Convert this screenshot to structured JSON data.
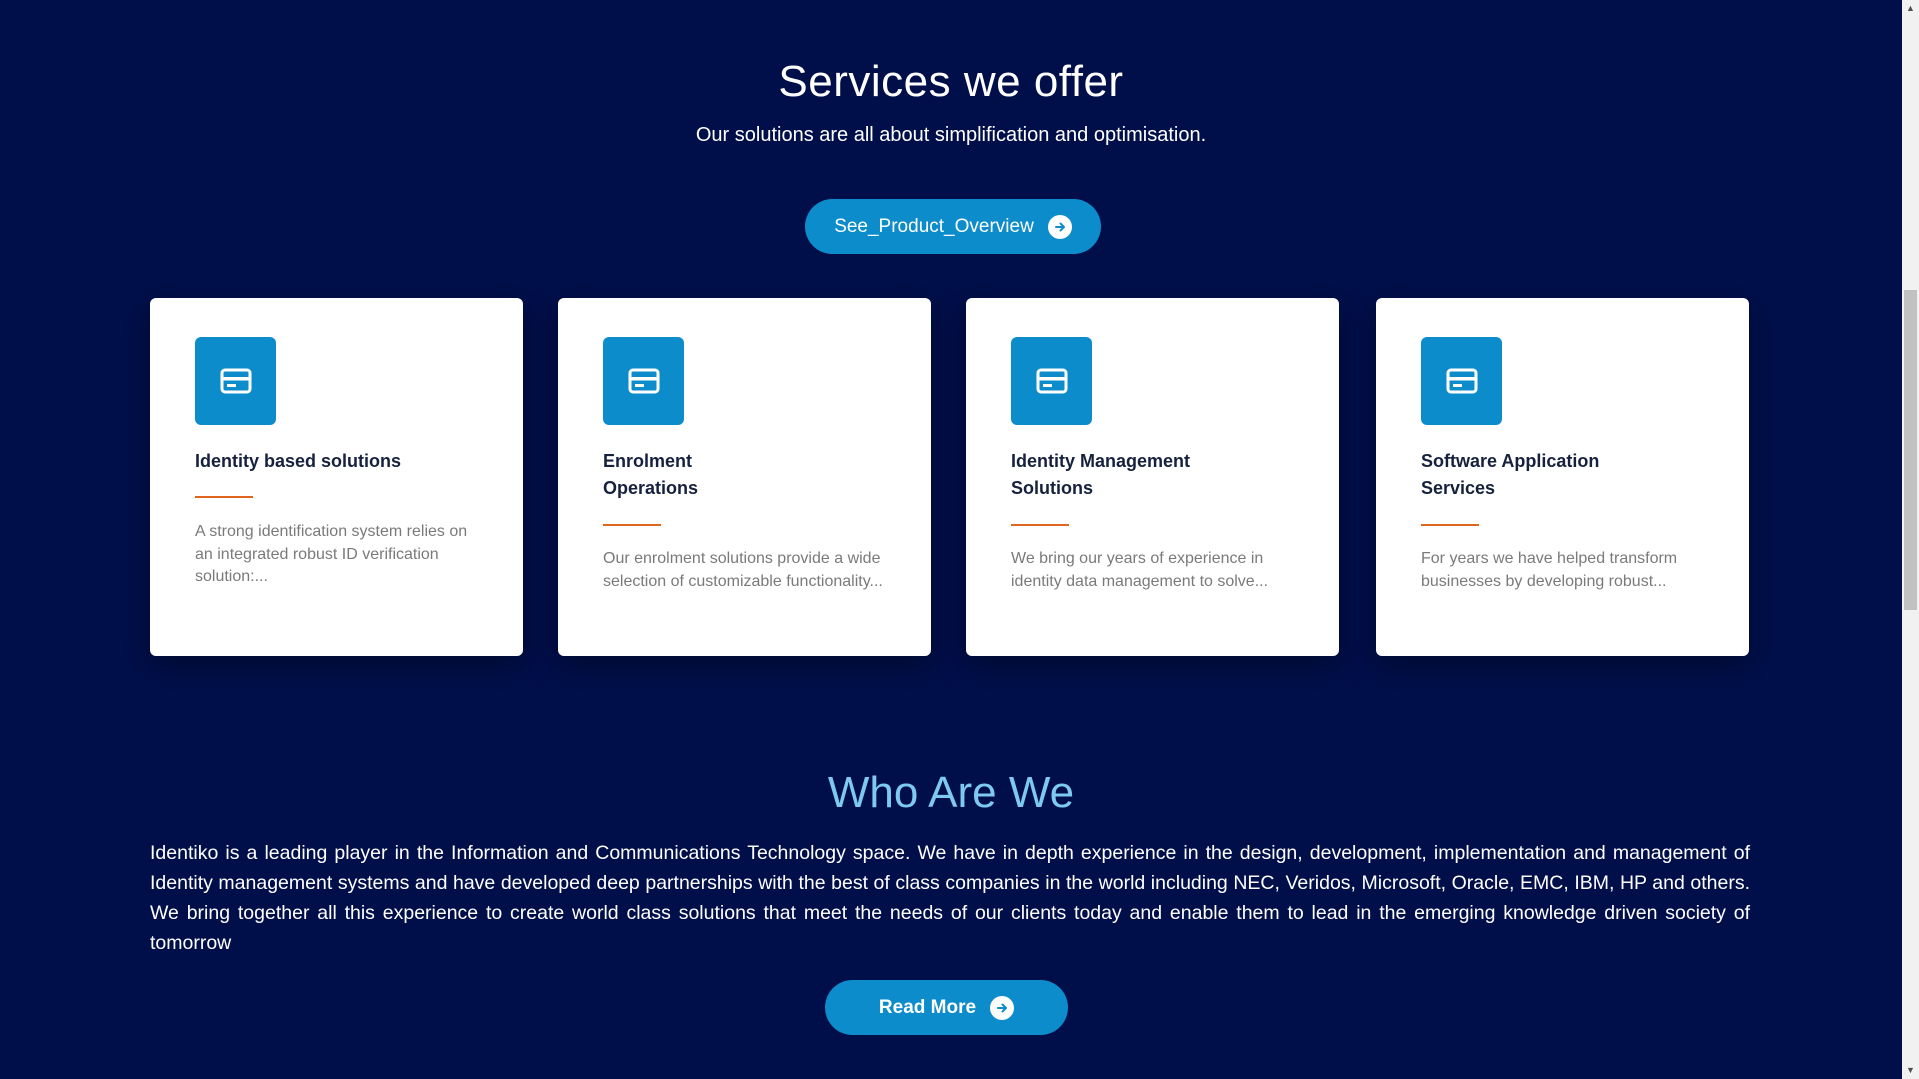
{
  "services": {
    "title": "Services we offer",
    "subtitle": "Our solutions are all about simplification and optimisation.",
    "overview_button": "See_Product_Overview"
  },
  "cards": [
    {
      "title": "Identity based solutions",
      "description": "A strong identification system relies on an integrated robust ID verification solution:..."
    },
    {
      "title": "Enrolment Operations",
      "description": "Our enrolment solutions provide a wide selection of customizable functionality..."
    },
    {
      "title": "Identity Management Solutions",
      "description": "We bring our years of experience in identity data management to solve..."
    },
    {
      "title": "Software Application Services",
      "description": "For years we have helped transform businesses by developing robust..."
    }
  ],
  "who": {
    "title": "Who Are We",
    "text": "Identiko is a leading player in the Information and Communications Technology space. We have in depth experience in the design, development, implementation and management of Identity management systems and have developed deep partnerships with the best of class companies in the world including NEC, Veridos, Microsoft, Oracle, EMC, IBM, HP and others. We bring together all this experience to create world class solutions that meet the needs of our clients today and enable them to lead in the emerging knowledge driven society of tomorrow",
    "read_more": "Read More"
  },
  "colors": {
    "background": "#000f4a",
    "accent": "#0d8ccc",
    "rule": "#e0651f",
    "who_title": "#7ec9f0"
  },
  "icons": {
    "card_icon": "credit-card-icon",
    "button_icon": "arrow-right-circle-icon"
  }
}
